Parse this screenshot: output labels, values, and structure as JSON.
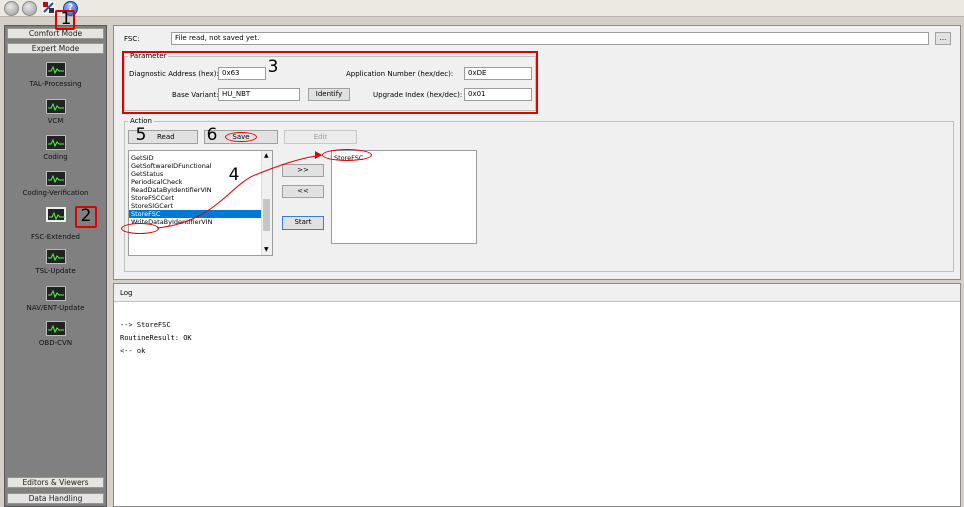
{
  "toolbar": {
    "icons": [
      "back-icon",
      "forward-icon",
      "tool-icon",
      "help-icon"
    ]
  },
  "sidebar": {
    "top_modes": [
      "Comfort Mode",
      "Expert Mode"
    ],
    "items": [
      {
        "label": "TAL-Processing"
      },
      {
        "label": "VCM"
      },
      {
        "label": "Coding"
      },
      {
        "label": "Coding-Verification"
      },
      {
        "label": "FSC-Extended"
      },
      {
        "label": "TSL-Update"
      },
      {
        "label": "NAV/ENT-Update"
      },
      {
        "label": "OBD-CVN"
      }
    ],
    "bottom_modes": [
      "Editors & Viewers",
      "Data Handling"
    ]
  },
  "fsc": {
    "label": "FSC:",
    "value": "File read, not saved yet.",
    "browse": "..."
  },
  "parameter": {
    "title": "Parameter",
    "diag_label": "Diagnostic Address (hex):",
    "diag_value": "0x63",
    "base_label": "Base Variant:",
    "base_value": "HU_NBT",
    "identify": "Identify",
    "app_label": "Application Number (hex/dec):",
    "app_value": "0xDE",
    "upg_label": "Upgrade Index (hex/dec):",
    "upg_value": "0x01"
  },
  "action": {
    "title": "Action",
    "read": "Read",
    "save": "Save",
    "edit": "Edit",
    "left_list": [
      "GetSID",
      "GetSoftwareIDFunctional",
      "GetStatus",
      "PeriodicalCheck",
      "ReadDataByIdentifierVIN",
      "StoreFSCCert",
      "StoreSIGCert",
      "StoreFSC",
      "WriteDataByIdentifierVIN"
    ],
    "right_list": [
      "StoreFSC"
    ],
    "add": ">>",
    "remove": "<<",
    "start": "Start"
  },
  "log": {
    "title": "Log",
    "lines": [
      "--> StoreFSC",
      "RoutineResult: OK",
      "<-- ok"
    ]
  },
  "annotations": [
    "1",
    "2",
    "3",
    "4",
    "5",
    "6"
  ],
  "colors": {
    "annotation": "#e00000",
    "selection": "#0078d7"
  }
}
